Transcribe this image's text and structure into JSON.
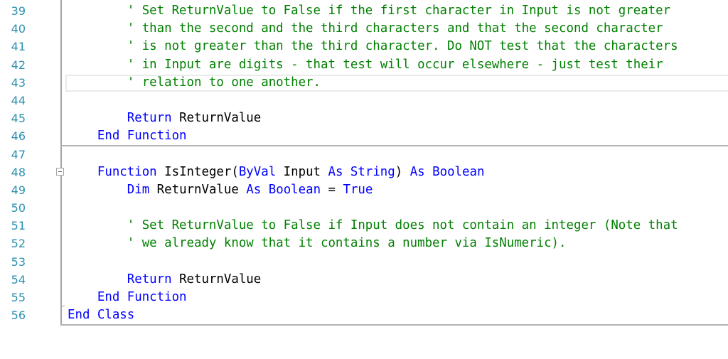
{
  "editor": {
    "colors": {
      "keyword": "#0000ff",
      "comment": "#008000",
      "text": "#000000",
      "line_number": "#2b91af"
    },
    "current_line": 43,
    "lines": [
      {
        "number": "39",
        "tokens": [
          {
            "t": "        ",
            "k": "tx"
          },
          {
            "t": "' Set ReturnValue to False if the first character in Input is not greater",
            "k": "cm"
          }
        ]
      },
      {
        "number": "40",
        "tokens": [
          {
            "t": "        ",
            "k": "tx"
          },
          {
            "t": "' than the second and the third characters and that the second character",
            "k": "cm"
          }
        ]
      },
      {
        "number": "41",
        "tokens": [
          {
            "t": "        ",
            "k": "tx"
          },
          {
            "t": "' is not greater than the third character. Do NOT test that the characters",
            "k": "cm"
          }
        ]
      },
      {
        "number": "42",
        "tokens": [
          {
            "t": "        ",
            "k": "tx"
          },
          {
            "t": "' in Input are digits - that test will occur elsewhere - just test their",
            "k": "cm"
          }
        ]
      },
      {
        "number": "43",
        "tokens": [
          {
            "t": "        ",
            "k": "tx"
          },
          {
            "t": "' relation to one another.",
            "k": "cm"
          }
        ]
      },
      {
        "number": "44",
        "tokens": []
      },
      {
        "number": "45",
        "tokens": [
          {
            "t": "        ",
            "k": "tx"
          },
          {
            "t": "Return",
            "k": "kw"
          },
          {
            "t": " ReturnValue",
            "k": "tx"
          }
        ]
      },
      {
        "number": "46",
        "tokens": [
          {
            "t": "    ",
            "k": "tx"
          },
          {
            "t": "End Function",
            "k": "kw"
          }
        ]
      },
      {
        "number": "47",
        "tokens": []
      },
      {
        "number": "48",
        "tokens": [
          {
            "t": "    ",
            "k": "tx"
          },
          {
            "t": "Function",
            "k": "kw"
          },
          {
            "t": " IsInteger(",
            "k": "tx"
          },
          {
            "t": "ByVal",
            "k": "kw"
          },
          {
            "t": " Input ",
            "k": "tx"
          },
          {
            "t": "As",
            "k": "kw"
          },
          {
            "t": " ",
            "k": "tx"
          },
          {
            "t": "String",
            "k": "kw"
          },
          {
            "t": ") ",
            "k": "tx"
          },
          {
            "t": "As",
            "k": "kw"
          },
          {
            "t": " ",
            "k": "tx"
          },
          {
            "t": "Boolean",
            "k": "kw"
          }
        ]
      },
      {
        "number": "49",
        "tokens": [
          {
            "t": "        ",
            "k": "tx"
          },
          {
            "t": "Dim",
            "k": "kw"
          },
          {
            "t": " ReturnValue ",
            "k": "tx"
          },
          {
            "t": "As",
            "k": "kw"
          },
          {
            "t": " ",
            "k": "tx"
          },
          {
            "t": "Boolean",
            "k": "kw"
          },
          {
            "t": " = ",
            "k": "tx"
          },
          {
            "t": "True",
            "k": "kw"
          }
        ]
      },
      {
        "number": "50",
        "tokens": []
      },
      {
        "number": "51",
        "tokens": [
          {
            "t": "        ",
            "k": "tx"
          },
          {
            "t": "' Set ReturnValue to False if Input does not contain an integer (Note that",
            "k": "cm"
          }
        ]
      },
      {
        "number": "52",
        "tokens": [
          {
            "t": "        ",
            "k": "tx"
          },
          {
            "t": "' we already know that it contains a number via IsNumeric).",
            "k": "cm"
          }
        ]
      },
      {
        "number": "53",
        "tokens": []
      },
      {
        "number": "54",
        "tokens": [
          {
            "t": "        ",
            "k": "tx"
          },
          {
            "t": "Return",
            "k": "kw"
          },
          {
            "t": " ReturnValue",
            "k": "tx"
          }
        ]
      },
      {
        "number": "55",
        "tokens": [
          {
            "t": "    ",
            "k": "tx"
          },
          {
            "t": "End Function",
            "k": "kw"
          }
        ]
      },
      {
        "number": "56",
        "tokens": [
          {
            "t": "End Class",
            "k": "kw"
          }
        ]
      }
    ],
    "outlining": {
      "collapse_button_line": 48,
      "collapse_icon": "minus-box-icon"
    }
  }
}
